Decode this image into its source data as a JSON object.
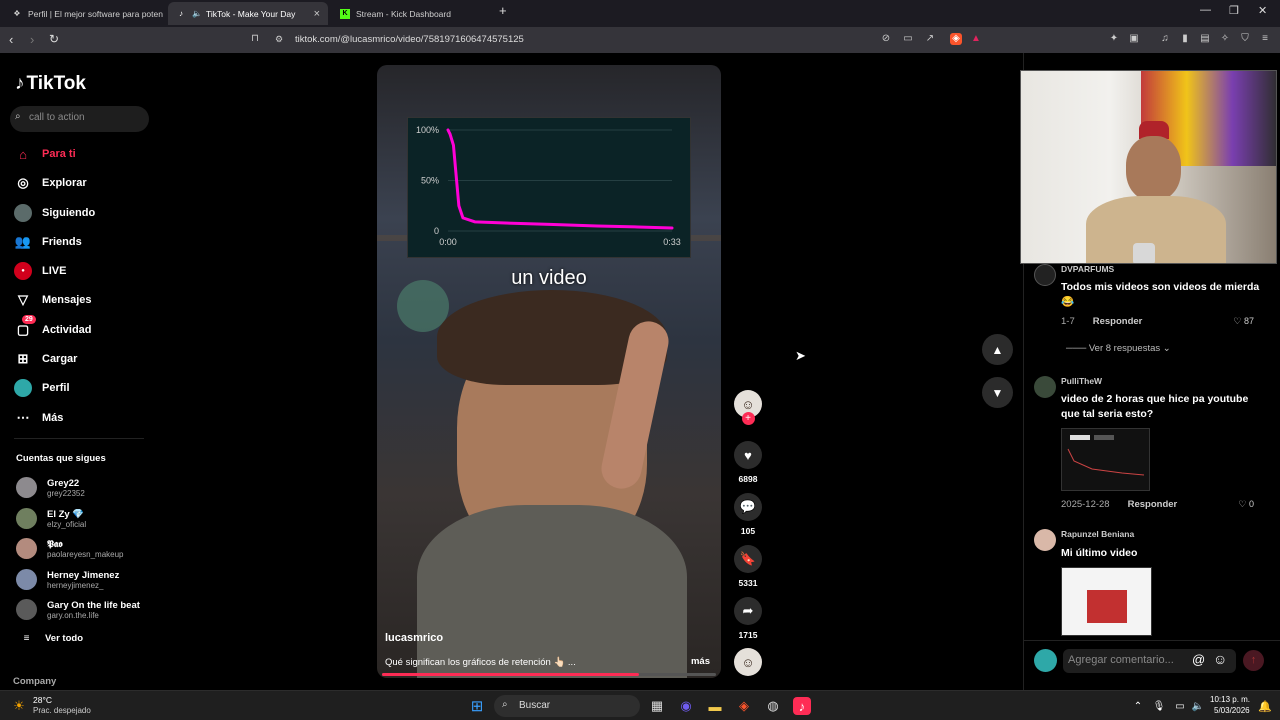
{
  "browser": {
    "tabs": [
      {
        "label": "Perfil | El mejor software para poten",
        "icon": "smart-icon"
      },
      {
        "label": "TikTok - Make Your Day",
        "icon": "tiktok-icon",
        "active": true
      },
      {
        "label": "Stream - Kick Dashboard",
        "icon": "kick-icon"
      }
    ],
    "url": "tiktok.com/@lucasmrico/video/7581971606474575125"
  },
  "sidebar": {
    "brand": "TikTok",
    "search_placeholder": "call to action",
    "nav": [
      {
        "label": "Para ti",
        "icon": "home-icon",
        "active": true
      },
      {
        "label": "Explorar",
        "icon": "compass-icon"
      },
      {
        "label": "Siguiendo",
        "icon": "following-avatar-icon"
      },
      {
        "label": "Friends",
        "icon": "friends-icon"
      },
      {
        "label": "LIVE",
        "icon": "live-icon"
      },
      {
        "label": "Mensajes",
        "icon": "send-icon"
      },
      {
        "label": "Actividad",
        "icon": "activity-icon",
        "badge": "29"
      },
      {
        "label": "Cargar",
        "icon": "upload-icon"
      },
      {
        "label": "Perfil",
        "icon": "profile-avatar-icon"
      },
      {
        "label": "Más",
        "icon": "more-icon"
      }
    ],
    "following_title": "Cuentas que sigues",
    "following": [
      {
        "name": "Grey22",
        "handle": "grey22352"
      },
      {
        "name": "El Zy 💎",
        "handle": "elzy_oficial"
      },
      {
        "name": "𝕻𝖆𝖔",
        "handle": "paolareyesn_makeup"
      },
      {
        "name": "Herney Jimenez",
        "handle": "herneyjimenez_"
      },
      {
        "name": "Gary On the life beat",
        "handle": "gary.on.the.life"
      }
    ],
    "see_all": "Ver todo",
    "company": "Company"
  },
  "video": {
    "caption": "un video",
    "username": "lucasmrico",
    "description": "Qué significan los gráficos de retención 👆🏻 ...",
    "more": "más",
    "progress": 0.77
  },
  "actions": {
    "likes": "6898",
    "comments": "105",
    "saves": "5331",
    "shares": "1715"
  },
  "chart_data": {
    "type": "line",
    "title": "",
    "xlabel": "",
    "ylabel": "",
    "x_ticks": [
      "0:00",
      "0:33"
    ],
    "y_ticks": [
      "100%",
      "50%",
      "0"
    ],
    "ylim": [
      0,
      100
    ],
    "xlim": [
      0,
      33
    ],
    "series": [
      {
        "color": "#ff00d6",
        "x": [
          0,
          0.3,
          0.8,
          1.2,
          1.6,
          2.2,
          4,
          8,
          15,
          22,
          28,
          33
        ],
        "y": [
          100,
          96,
          85,
          55,
          25,
          13,
          9,
          8,
          6.5,
          5,
          4,
          3
        ]
      }
    ],
    "grid": true
  },
  "comments": [
    {
      "author": "DVPARFUMS",
      "text": "Todos mis videos son videos de mierda 😂",
      "date": "1-7",
      "reply": "Responder",
      "likes": "87",
      "view_replies": "Ver 8 respuestas"
    },
    {
      "author": "PulliTheW",
      "text": "video de 2 horas que hice pa youtube que tal seria esto?",
      "date": "2025-12-28",
      "reply": "Responder",
      "likes": "0"
    },
    {
      "author": "Rapunzel Beniana",
      "text": "Mi último video"
    }
  ],
  "comment_input_placeholder": "Agregar comentario...",
  "taskbar": {
    "weather_temp": "28°C",
    "weather_desc": "Prac. despejado",
    "search": "Buscar",
    "time": "10:13 p. m.",
    "date": "5/03/2026"
  },
  "colors": {
    "accent": "#fe2c55",
    "chart_line": "#ff00d6"
  }
}
